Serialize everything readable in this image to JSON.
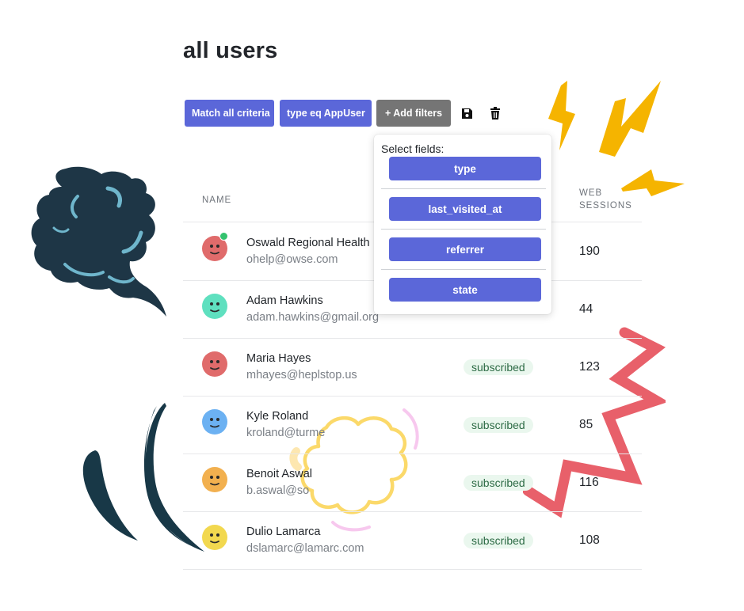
{
  "page": {
    "title": "all users"
  },
  "toolbar": {
    "match_label": "Match all criteria",
    "filter_label": "type eq AppUser",
    "add_filters_label": "+ Add filters",
    "save_icon": "save-icon",
    "delete_icon": "trash-icon"
  },
  "table": {
    "columns": {
      "name": "NAME",
      "sessions_line1": "WEB",
      "sessions_line2": "SESSIONS"
    },
    "rows": [
      {
        "name": "Oswald Regional Health",
        "email": "ohelp@owse.com",
        "status": "",
        "sessions": "190",
        "avatar_color": "#e06b6b",
        "online": true
      },
      {
        "name": "Adam Hawkins",
        "email": "adam.hawkins@gmail.org",
        "status": "",
        "sessions": "44",
        "avatar_color": "#5fe0bf",
        "online": false
      },
      {
        "name": "Maria Hayes",
        "email": "mhayes@heplstop.us",
        "status": "subscribed",
        "sessions": "123",
        "avatar_color": "#e06b6b",
        "online": false
      },
      {
        "name": "Kyle Roland",
        "email": "kroland@turme",
        "status": "subscribed",
        "sessions": "85",
        "avatar_color": "#6cb1f2",
        "online": false
      },
      {
        "name": "Benoit Aswal",
        "email": "b.aswal@so",
        "status": "subscribed",
        "sessions": "116",
        "avatar_color": "#f2b04f",
        "online": false
      },
      {
        "name": "Dulio Lamarca",
        "email": "dslamarc@lamarc.com",
        "status": "subscribed",
        "sessions": "108",
        "avatar_color": "#f2d84f",
        "online": false
      }
    ]
  },
  "dropdown": {
    "label": "Select fields:",
    "fields": [
      "type",
      "last_visited_at",
      "referrer",
      "state"
    ]
  },
  "colors": {
    "accent": "#5b67d9",
    "gray_button": "#757575",
    "status_bg": "#eaf7ee",
    "status_text": "#2d6b45",
    "online": "#34c26e"
  }
}
